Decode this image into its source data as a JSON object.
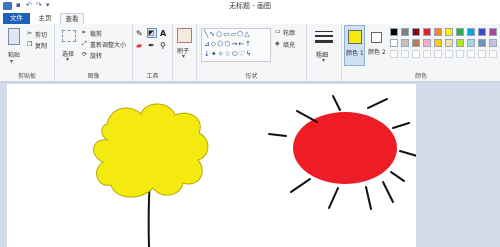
{
  "window": {
    "title": "无标题 - 画图"
  },
  "tabs": {
    "file": "文件",
    "home": "主页",
    "view": "查看"
  },
  "clipboard": {
    "paste": "粘贴",
    "cut": "剪切",
    "copy": "复制",
    "label": "剪贴板"
  },
  "image": {
    "select": "选择",
    "crop": "裁剪",
    "resize": "重新调整大小",
    "rotate": "旋转",
    "label": "图像"
  },
  "tools": {
    "label": "工具"
  },
  "brushes": {
    "label": "刷子"
  },
  "shapes": {
    "outline": "轮廓",
    "fill": "填充",
    "label": "形状"
  },
  "size": {
    "label": "粗细"
  },
  "colors": {
    "color1": "颜色 1",
    "color2": "颜色 2",
    "label": "颜色",
    "color1_value": "#f4ea10",
    "color2_value": "#ffffff",
    "palette_row1": [
      "#000000",
      "#7f7f7f",
      "#880015",
      "#ed1c24",
      "#ff7f27",
      "#fff200",
      "#22b14c",
      "#00a2e8",
      "#3f48cc",
      "#a349a4"
    ],
    "palette_row2": [
      "#ffffff",
      "#c3c3c3",
      "#b97a57",
      "#ffaec9",
      "#ffc90e",
      "#efe4b0",
      "#b5e61d",
      "#99d9ea",
      "#7092be",
      "#c8bfe7"
    ]
  },
  "drawing": {
    "flower_color": "#f4ea10",
    "sun_color": "#ee1c24",
    "stroke_color": "#111111"
  }
}
